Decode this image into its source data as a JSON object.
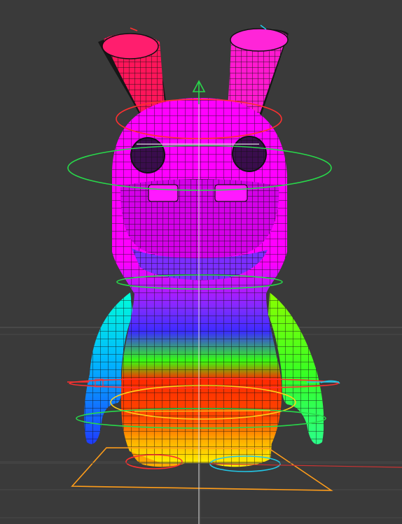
{
  "viewport": {
    "background": "#3a3a3a",
    "grid_color": "#4a4a4a",
    "horizon_color": "#555555"
  },
  "model": {
    "wireframe_color": "#111111",
    "gradient": [
      "#ff00ff",
      "#8a2cff",
      "#2a35ff",
      "#14d0ff",
      "#27ff1f",
      "#ffea00",
      "#ff6a00",
      "#ff1500",
      "#ff7f00",
      "#ffe600"
    ]
  },
  "rig_controls": {
    "colors": {
      "red": "#ff3030",
      "green": "#28d84a",
      "blue": "#2f9bff",
      "cyan": "#22c8e8",
      "yellow": "#ffd11a",
      "orange": "#ff9d1a"
    }
  }
}
